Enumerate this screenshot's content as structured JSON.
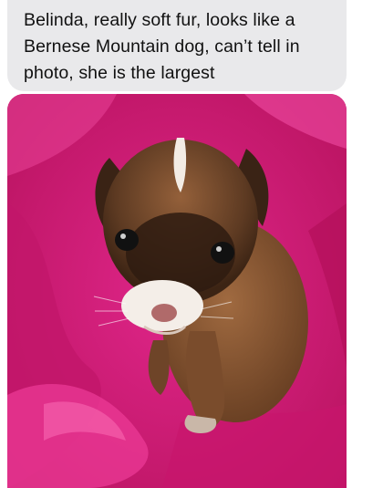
{
  "message": {
    "text": "Belinda, really soft fur, looks like a Bernese Mountain dog, can’t tell in photo, she is the largest",
    "bubble_color": "#e9e9eb",
    "text_color": "#111111"
  },
  "photo": {
    "subject_icon": "puppy-on-pink-towel",
    "towel_color": "#d81e7a",
    "fur_color": "#8a5a34"
  }
}
